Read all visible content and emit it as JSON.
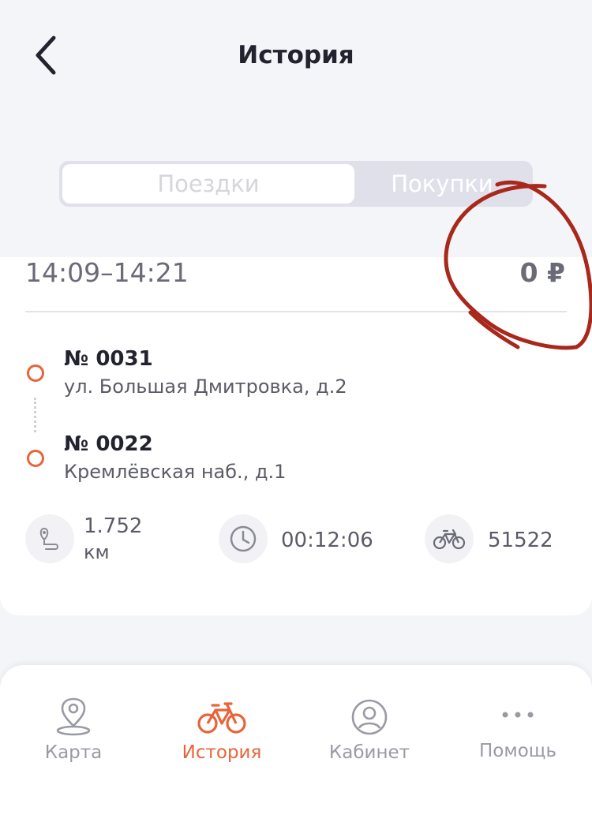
{
  "header": {
    "title": "История",
    "back_icon": "chevron-left-icon"
  },
  "segments": {
    "trips": "Поездки",
    "purchases": "Покупки",
    "active": "trips"
  },
  "trip": {
    "time_range": "14:09–14:21",
    "price": "0 ₽",
    "start": {
      "number": "№ 0031",
      "address": "ул. Большая Дмитровка, д.2"
    },
    "end": {
      "number": "№ 0022",
      "address": "Кремлёвская наб., д.1"
    },
    "distance_value": "1.752",
    "distance_unit": "км",
    "duration": "00:12:06",
    "bike_id": "51522"
  },
  "tabbar": {
    "items": [
      {
        "label": "Карта",
        "icon": "map-pin-icon"
      },
      {
        "label": "История",
        "icon": "bike-icon",
        "active": true
      },
      {
        "label": "Кабинет",
        "icon": "user-icon"
      },
      {
        "label": "Помощь",
        "icon": "more-dots-icon"
      }
    ]
  },
  "colors": {
    "accent": "#e8643a",
    "background": "#f4f5f9",
    "text_dark": "#23232f",
    "text_muted": "#6b6b78",
    "annotation": "#a8281b"
  }
}
